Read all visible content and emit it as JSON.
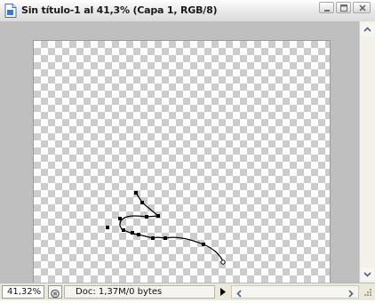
{
  "window": {
    "title": "Sin título-1 al 41,3% (Capa 1, RGB/8)"
  },
  "icons": {
    "document": "document-icon",
    "minimize": "minimize-icon",
    "maximize": "maximize-icon",
    "close": "close-icon",
    "scroll_up": "chevron-up-icon",
    "scroll_down": "chevron-down-icon",
    "scroll_left": "chevron-left-icon",
    "scroll_right": "chevron-right-icon",
    "status_menu": "triangle-right-icon",
    "status_options": "status-options-icon"
  },
  "canvas": {
    "background": "transparent checkerboard",
    "path": {
      "type": "pen-path-with-anchor-points",
      "anchor_count": 13
    }
  },
  "statusbar": {
    "zoom": "41,32%",
    "doc_info": "Doc: 1,37M/0 bytes"
  },
  "colors": {
    "workspace": "#bfbfbf",
    "checker_dark": "#cccccc",
    "checker_light": "#ffffff",
    "path": "#000000"
  }
}
